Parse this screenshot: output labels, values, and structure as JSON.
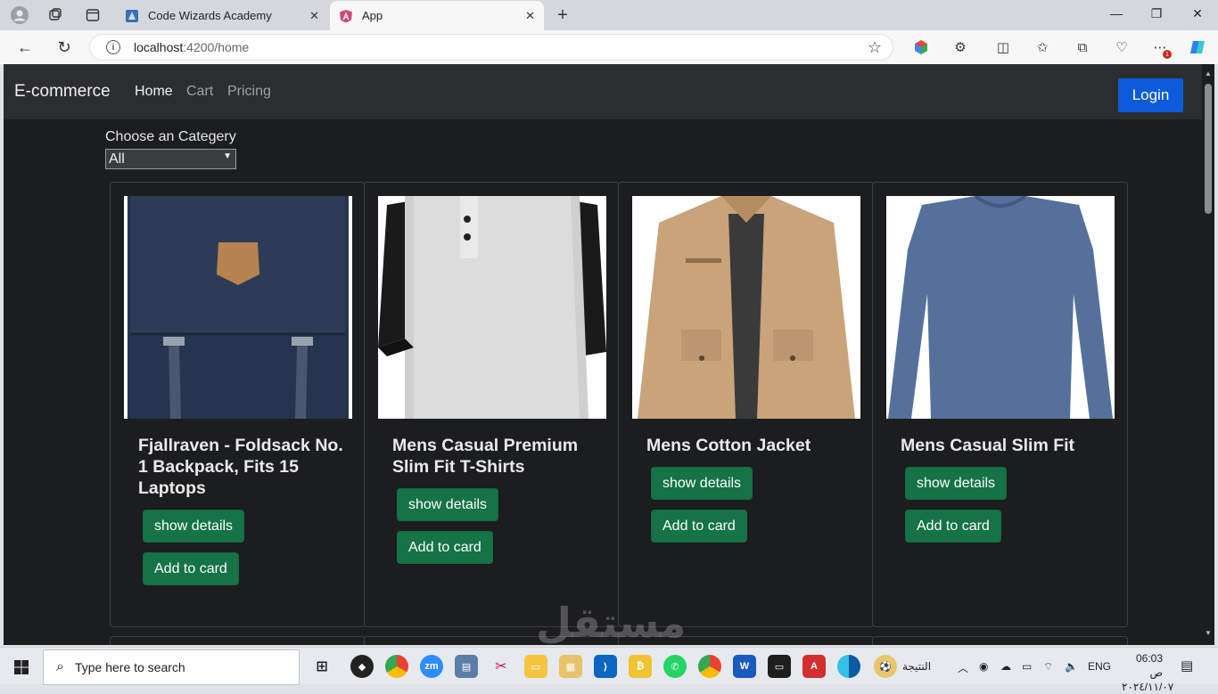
{
  "browser": {
    "tabs": [
      {
        "title": "Code Wizards Academy",
        "active": false
      },
      {
        "title": "App",
        "active": true
      }
    ],
    "url_host": "localhost",
    "url_path": ":4200/home",
    "new_tab_symbol": "+",
    "notification_badge": "1"
  },
  "navbar": {
    "brand": "E-commerce",
    "links": [
      "Home",
      "Cart",
      "Pricing"
    ],
    "login": "Login"
  },
  "filter": {
    "label": "Choose an Categery",
    "selected": "All"
  },
  "products": [
    {
      "title": "Fjallraven - Foldsack No. 1 Backpack, Fits 15 Laptops",
      "image": "navy-backpack"
    },
    {
      "title": "Mens Casual Premium Slim Fit T-Shirts",
      "image": "raglan-tshirt"
    },
    {
      "title": "Mens Cotton Jacket",
      "image": "khaki-jacket"
    },
    {
      "title": "Mens Casual Slim Fit",
      "image": "blue-longsleeve"
    }
  ],
  "buttons": {
    "details": "show details",
    "add": "Add to card"
  },
  "watermark": "مستقل",
  "taskbar": {
    "search_placeholder": "Type here to search",
    "weather_text": "النتيجة",
    "lang": "ENG",
    "time": "06:03 ص",
    "date": "٢٠٢٤/١١/٠٧"
  },
  "colors": {
    "page_bg": "#1c1d1f",
    "navbar_bg": "#2b2d30",
    "login_blue": "#0d5bd8",
    "button_green": "#157347"
  }
}
